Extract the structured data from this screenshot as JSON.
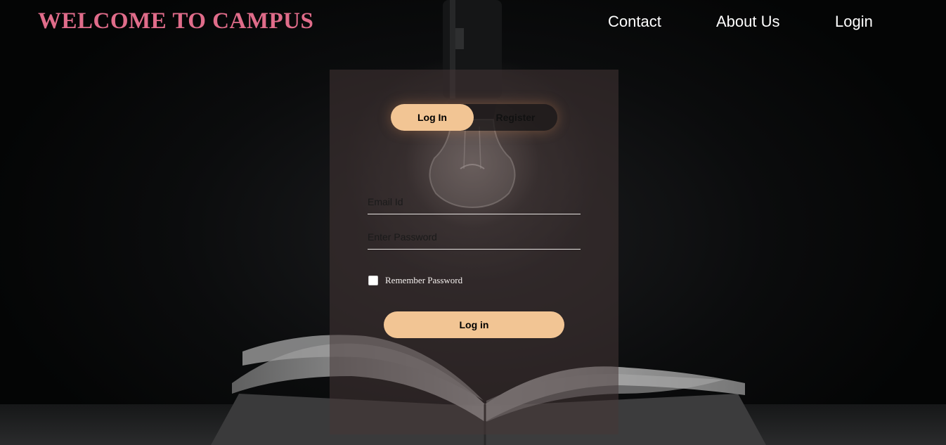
{
  "header": {
    "title": "WELCOME TO CAMPUS",
    "title_color": "#e06c8a",
    "nav": {
      "contact": "Contact",
      "about": "About Us",
      "login": "Login"
    }
  },
  "form": {
    "tabs": {
      "login": "Log In",
      "register": "Register",
      "active": "login"
    },
    "email": {
      "placeholder": "Email Id",
      "value": ""
    },
    "password": {
      "placeholder": "Enter Password",
      "value": ""
    },
    "remember": {
      "label": "Remember Password",
      "checked": false
    },
    "submit_label": "Log in",
    "accent_color": "#f2c594"
  },
  "background": {
    "icons": [
      "light-bulb-icon",
      "open-book-icon"
    ]
  }
}
